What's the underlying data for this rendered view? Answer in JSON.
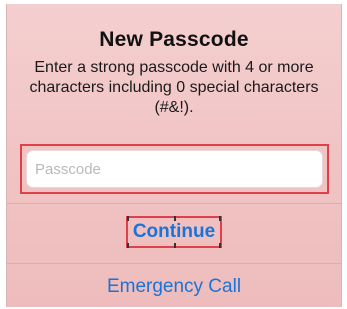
{
  "dialog": {
    "title": "New Passcode",
    "message": "Enter a strong passcode with 4 or more characters including 0 special characters (#&!).",
    "passcode_input": {
      "value": "",
      "placeholder": "Passcode"
    },
    "continue_label": "Continue",
    "emergency_label": "Emergency Call"
  },
  "colors": {
    "accent": "#1a73d9",
    "highlight": "#e0404a",
    "background": "#f1c4c4"
  }
}
